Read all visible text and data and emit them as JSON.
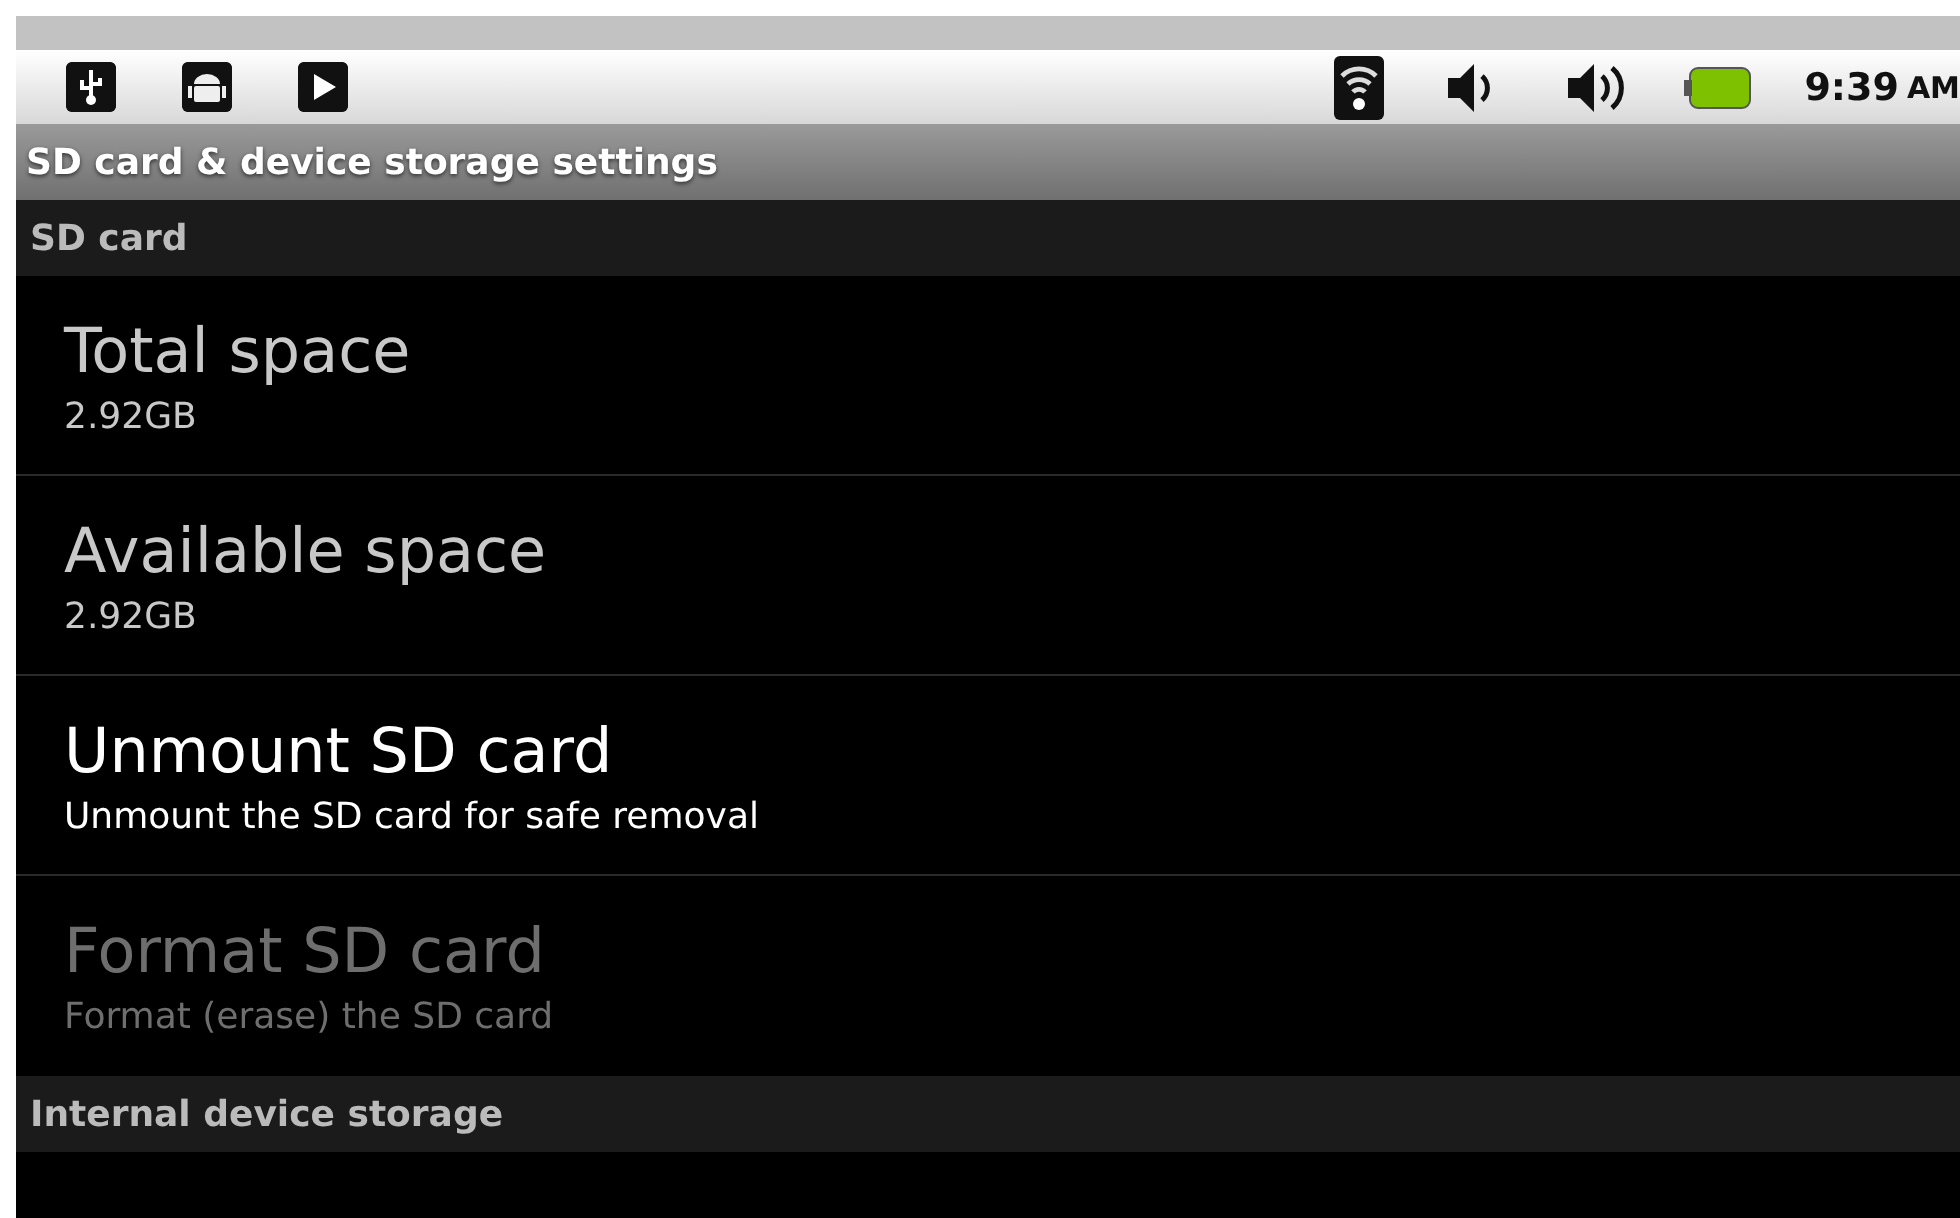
{
  "status_bar": {
    "time": "9:39",
    "meridiem": "AM"
  },
  "title_bar": {
    "title": "SD card & device storage settings"
  },
  "sections": [
    {
      "header": "SD card",
      "items": [
        {
          "title": "Total space",
          "summary": "2.92GB",
          "kind": "info",
          "disabled": false
        },
        {
          "title": "Available space",
          "summary": "2.92GB",
          "kind": "info",
          "disabled": false
        },
        {
          "title": "Unmount SD card",
          "summary": "Unmount the SD card for safe removal",
          "kind": "action",
          "disabled": false
        },
        {
          "title": "Format SD card",
          "summary": "Format (erase) the SD card",
          "kind": "action",
          "disabled": true
        }
      ]
    },
    {
      "header": "Internal device storage"
    }
  ]
}
